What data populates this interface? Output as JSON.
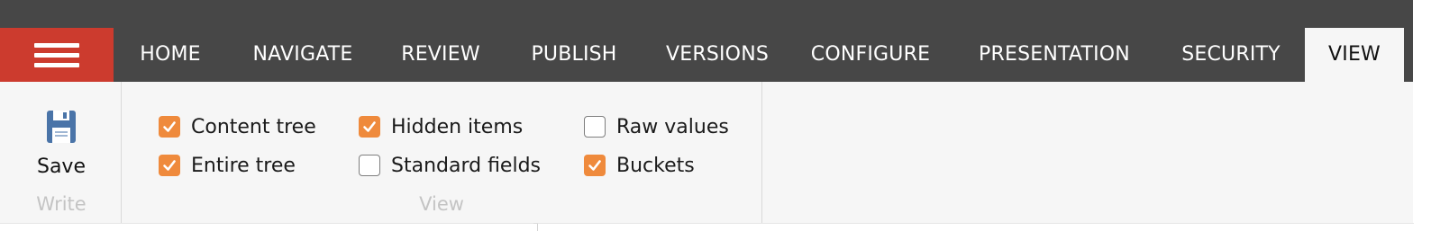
{
  "tabs": [
    {
      "label": "HOME"
    },
    {
      "label": "NAVIGATE"
    },
    {
      "label": "REVIEW"
    },
    {
      "label": "PUBLISH"
    },
    {
      "label": "VERSIONS"
    },
    {
      "label": "CONFIGURE"
    },
    {
      "label": "PRESENTATION"
    },
    {
      "label": "SECURITY"
    },
    {
      "label": "VIEW"
    }
  ],
  "active_tab": "VIEW",
  "write_group": {
    "save_label": "Save",
    "save_icon": "floppy-disk-icon",
    "group_label": "Write"
  },
  "view_group": {
    "group_label": "View",
    "options": [
      {
        "label": "Content tree",
        "checked": true
      },
      {
        "label": "Entire tree",
        "checked": true
      },
      {
        "label": "Hidden items",
        "checked": true
      },
      {
        "label": "Standard fields",
        "checked": false
      },
      {
        "label": "Raw values",
        "checked": false
      },
      {
        "label": "Buckets",
        "checked": true
      }
    ]
  },
  "colors": {
    "topbar": "#474747",
    "menu_button": "#cc3b2e",
    "checkbox_checked": "#ef8a3c",
    "ribbon_bg": "#f6f6f6",
    "save_icon": "#4a74a8"
  }
}
